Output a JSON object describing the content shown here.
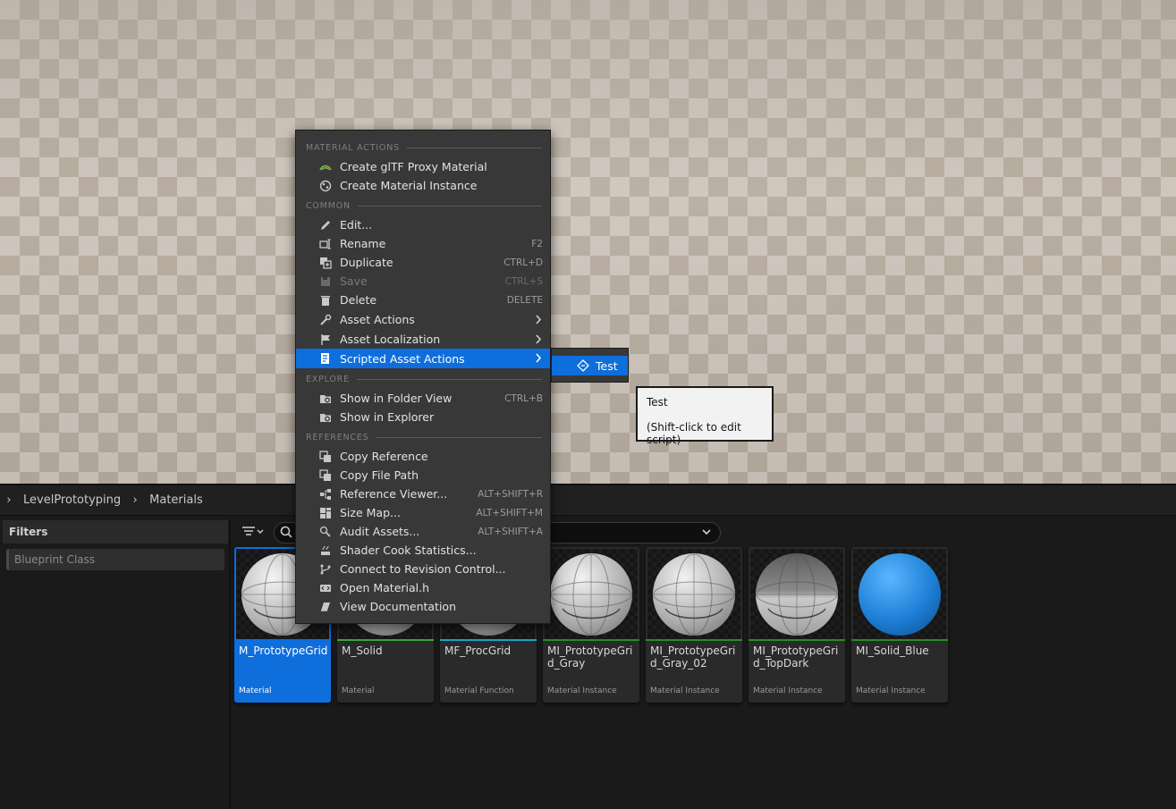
{
  "breadcrumb": {
    "items": [
      "LevelPrototyping",
      "Materials"
    ]
  },
  "filters": {
    "title": "Filters",
    "chip": "Blueprint Class"
  },
  "context_menu": {
    "sections": {
      "material_actions": "MATERIAL ACTIONS",
      "common": "COMMON",
      "explore": "EXPLORE",
      "references": "REFERENCES"
    },
    "items": [
      {
        "label": "Create glTF Proxy Material",
        "shortcut": "",
        "icon": "gltf-icon"
      },
      {
        "label": "Create Material Instance",
        "shortcut": "",
        "icon": "material-instance-icon"
      },
      {
        "label": "Edit...",
        "shortcut": "",
        "icon": "pencil-icon"
      },
      {
        "label": "Rename",
        "shortcut": "F2",
        "icon": "rename-icon"
      },
      {
        "label": "Duplicate",
        "shortcut": "CTRL+D",
        "icon": "duplicate-icon"
      },
      {
        "label": "Save",
        "shortcut": "CTRL+S",
        "icon": "save-icon"
      },
      {
        "label": "Delete",
        "shortcut": "DELETE",
        "icon": "trash-icon"
      },
      {
        "label": "Asset Actions",
        "shortcut": "",
        "icon": "wrench-icon"
      },
      {
        "label": "Asset Localization",
        "shortcut": "",
        "icon": "flag-icon"
      },
      {
        "label": "Scripted Asset Actions",
        "shortcut": "",
        "icon": "script-icon"
      },
      {
        "label": "Show in Folder View",
        "shortcut": "CTRL+B",
        "icon": "folder-search-icon"
      },
      {
        "label": "Show in Explorer",
        "shortcut": "",
        "icon": "folder-search-icon"
      },
      {
        "label": "Copy Reference",
        "shortcut": "",
        "icon": "copy-icon"
      },
      {
        "label": "Copy File Path",
        "shortcut": "",
        "icon": "copy-icon"
      },
      {
        "label": "Reference Viewer...",
        "shortcut": "ALT+SHIFT+R",
        "icon": "reference-viewer-icon"
      },
      {
        "label": "Size Map...",
        "shortcut": "ALT+SHIFT+M",
        "icon": "size-map-icon"
      },
      {
        "label": "Audit Assets...",
        "shortcut": "ALT+SHIFT+A",
        "icon": "audit-icon"
      },
      {
        "label": "Shader Cook Statistics...",
        "shortcut": "",
        "icon": "cook-icon"
      },
      {
        "label": "Connect to Revision Control...",
        "shortcut": "",
        "icon": "branch-icon"
      },
      {
        "label": "Open Material.h",
        "shortcut": "",
        "icon": "code-icon"
      },
      {
        "label": "View Documentation",
        "shortcut": "",
        "icon": "book-icon"
      }
    ]
  },
  "submenu": {
    "label": "Test",
    "icon": "script-action-icon"
  },
  "tooltip": {
    "line1": "Test",
    "line2": "(Shift-click to edit script)"
  },
  "assets": [
    {
      "name": "M_PrototypeGrid",
      "type": "Material",
      "bar_color": "#0e6edc",
      "selected": true
    },
    {
      "name": "M_Solid",
      "type": "Material",
      "bar_color": "#3aa63a",
      "selected": false
    },
    {
      "name": "MF_ProcGrid",
      "type": "Material Function",
      "bar_color": "#19a6c6",
      "selected": false
    },
    {
      "name": "MI_PrototypeGrid_Gray",
      "type": "Material Instance",
      "bar_color": "#2a8a2a",
      "selected": false
    },
    {
      "name": "MI_PrototypeGrid_Gray_02",
      "type": "Material Instance",
      "bar_color": "#2a8a2a",
      "selected": false
    },
    {
      "name": "MI_PrototypeGrid_TopDark",
      "type": "Material Instance",
      "bar_color": "#2a8a2a",
      "selected": false
    },
    {
      "name": "MI_Solid_Blue",
      "type": "Material Instance",
      "bar_color": "#2a8a2a",
      "selected": false
    }
  ],
  "colors": {
    "accent": "#0e6edc",
    "menu_bg": "#383838",
    "panel_bg": "#1a1a1a"
  }
}
